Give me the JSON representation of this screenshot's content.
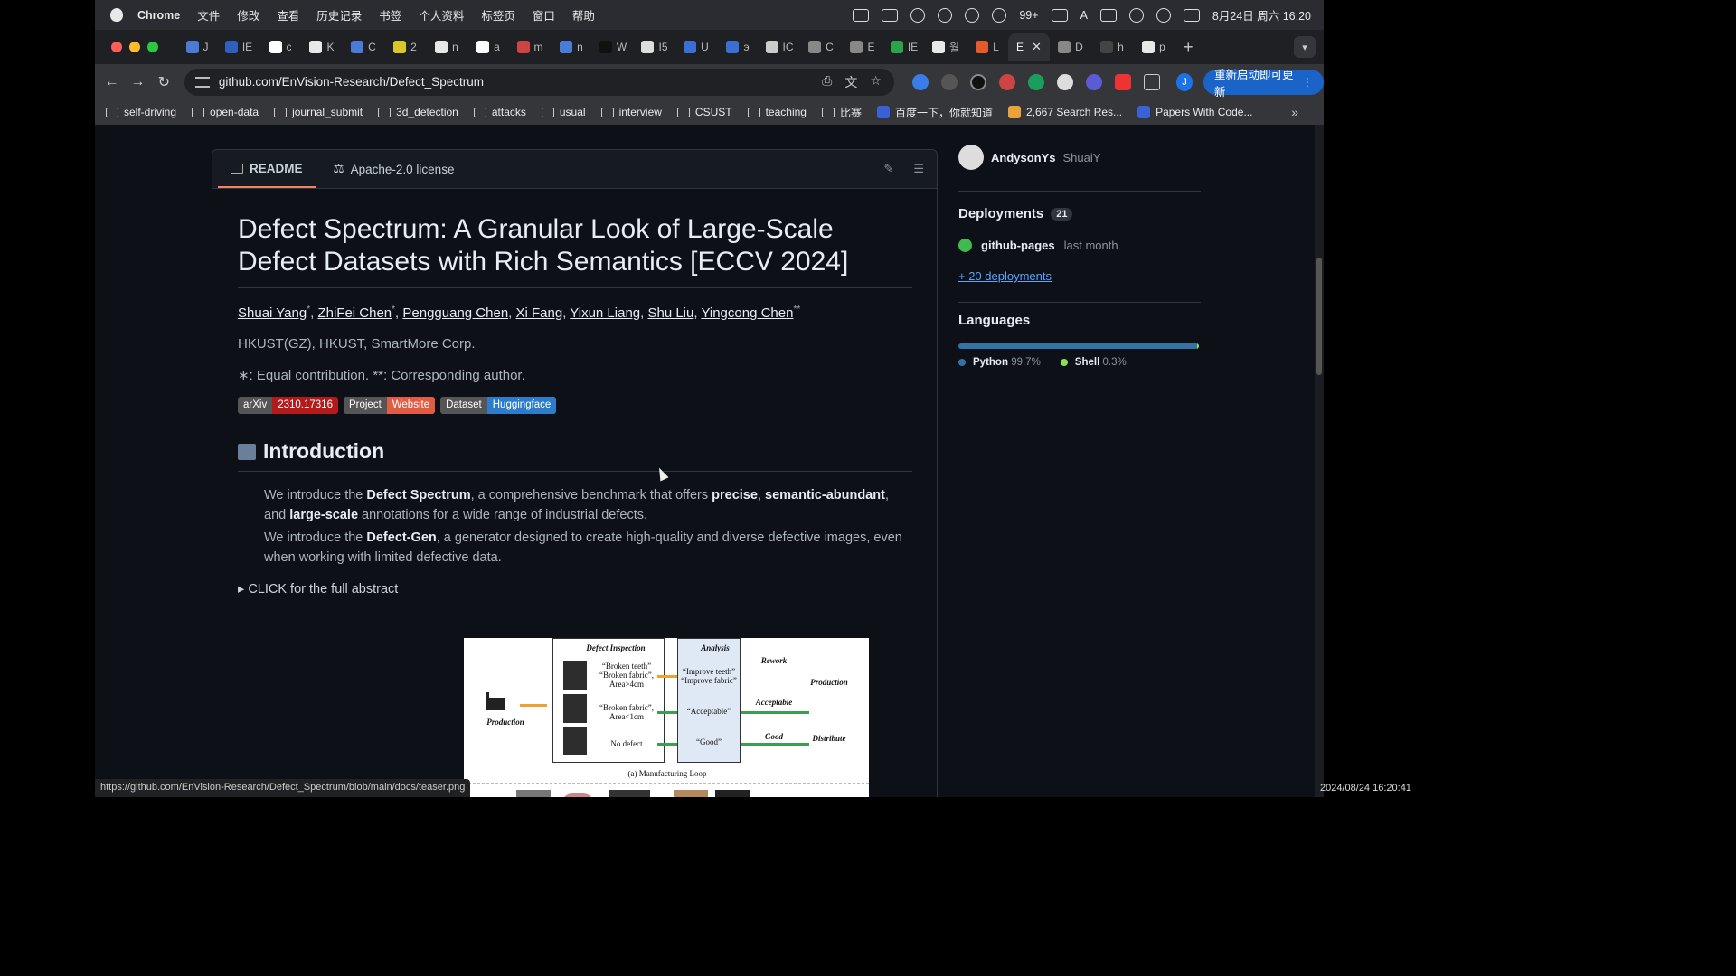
{
  "menubar": {
    "app": "Chrome",
    "items": [
      "文件",
      "修改",
      "查看",
      "历史记录",
      "书签",
      "个人资料",
      "标签页",
      "窗口",
      "帮助"
    ],
    "wechat_badge": "99+",
    "input_indicator": "A",
    "datetime": "8月24日 周六 16:20"
  },
  "tabs": [
    {
      "label": "J",
      "color": "#4a7bd6"
    },
    {
      "label": "IE",
      "color": "#2f5fbf"
    },
    {
      "label": "c",
      "color": "#ffffff"
    },
    {
      "label": "K",
      "color": "#e8e8e8"
    },
    {
      "label": "C",
      "color": "#4a7bd6"
    },
    {
      "label": "2",
      "color": "#d9c629"
    },
    {
      "label": "n",
      "color": "#e8e8e8"
    },
    {
      "label": "a",
      "color": "#ffffff"
    },
    {
      "label": "m",
      "color": "#c44"
    },
    {
      "label": "n",
      "color": "#4a7bd6"
    },
    {
      "label": "W",
      "color": "#111111"
    },
    {
      "label": "I5",
      "color": "#dddddd"
    },
    {
      "label": "U",
      "color": "#3b6fd6"
    },
    {
      "label": "э",
      "color": "#3b6fd6"
    },
    {
      "label": "IC",
      "color": "#cccccc"
    },
    {
      "label": "C",
      "color": "#888888"
    },
    {
      "label": "E",
      "color": "#888888"
    },
    {
      "label": "IE",
      "color": "#2aa34a"
    },
    {
      "label": "월",
      "color": "#e8e8e8"
    },
    {
      "label": "L",
      "color": "#e55a2b"
    },
    {
      "label": "E",
      "color": "#2f3035",
      "active": true
    },
    {
      "label": "D",
      "color": "#888888"
    },
    {
      "label": "h",
      "color": "#444444"
    },
    {
      "label": "p",
      "color": "#e8e8e8"
    }
  ],
  "toolbar": {
    "url": "github.com/EnVision-Research/Defect_Spectrum",
    "profile_initial": "J",
    "update_label": "重新启动即可更新"
  },
  "bookmarks": [
    {
      "label": "self-driving",
      "type": "folder"
    },
    {
      "label": "open-data",
      "type": "folder"
    },
    {
      "label": "journal_submit",
      "type": "folder"
    },
    {
      "label": "3d_detection",
      "type": "folder"
    },
    {
      "label": "attacks",
      "type": "folder"
    },
    {
      "label": "usual",
      "type": "folder"
    },
    {
      "label": "interview",
      "type": "folder"
    },
    {
      "label": "CSUST",
      "type": "folder"
    },
    {
      "label": "teaching",
      "type": "folder"
    },
    {
      "label": "比赛",
      "type": "folder"
    },
    {
      "label": "百度一下，你就知道",
      "type": "site",
      "color": "#3a62d6"
    },
    {
      "label": "2,667 Search Res...",
      "type": "site",
      "color": "#e8a33a"
    },
    {
      "label": "Papers With Code...",
      "type": "site",
      "color": "#3a62d6"
    }
  ],
  "readme": {
    "tab_readme": "README",
    "tab_license": "Apache-2.0 license",
    "title": "Defect Spectrum: A Granular Look of Large-Scale Defect Datasets with Rich Semantics [ECCV 2024]",
    "authors": [
      {
        "name": "Shuai Yang",
        "sup": "*"
      },
      {
        "name": "ZhiFei Chen",
        "sup": "*"
      },
      {
        "name": "Pengguang Chen",
        "sup": ""
      },
      {
        "name": "Xi Fang",
        "sup": ""
      },
      {
        "name": "Yixun Liang",
        "sup": ""
      },
      {
        "name": "Shu Liu",
        "sup": ""
      },
      {
        "name": "Yingcong Chen",
        "sup": "**"
      }
    ],
    "affiliations": "HKUST(GZ), HKUST, SmartMore Corp.",
    "contribution_note": "∗: Equal contribution. **: Corresponding author.",
    "badges": [
      {
        "left": "arXiv",
        "right": "2310.17316",
        "color": "#b31b1b"
      },
      {
        "left": "Project",
        "right": "Website",
        "color": "#e05d44"
      },
      {
        "left": "Dataset",
        "right": "Huggingface",
        "color": "#2d7cc9"
      }
    ],
    "intro_heading": "Introduction",
    "intro_p1": {
      "a": "We introduce the ",
      "b": "Defect Spectrum",
      "c": ", a comprehensive benchmark that offers ",
      "d": "precise",
      "e": ", ",
      "f": "semantic-abundant",
      "g": ", and ",
      "h": "large-scale",
      "i": " annotations for a wide range of industrial defects."
    },
    "intro_p2": {
      "a": "We introduce the ",
      "b": "Defect-Gen",
      "c": ", a generator designed to create high-quality and diverse defective images, even when working with limited defective data."
    },
    "abstract_toggle": "CLICK for the full abstract",
    "teaser": {
      "defect_inspection": "Defect Inspection",
      "analysis": "Analysis",
      "production": "Production",
      "q1": "“Broken teeth” “Broken fabric”, Area>4cm",
      "q2": "“Broken fabric”, Area<1cm",
      "q3": "No defect",
      "a1": "“Improve teeth” “Improve fabric”",
      "a2": "“Acceptable”",
      "a3": "“Good”",
      "rework": "Rework",
      "acceptable": "Acceptable",
      "good": "Good",
      "production_out": "Production",
      "distribute": "Distribute",
      "caption": "(a) Manufacturing Loop"
    }
  },
  "sidebar": {
    "contributor_name": "AndysonYs",
    "contributor_login": "ShuaiY",
    "deployments_title": "Deployments",
    "deployments_count": "21",
    "deployment_env": "github-pages",
    "deployment_time": "last month",
    "more_deployments": "+ 20 deployments",
    "languages_title": "Languages",
    "languages": [
      {
        "name": "Python",
        "percent": "99.7%",
        "color": "#3572A5",
        "share": 99.7
      },
      {
        "name": "Shell",
        "percent": "0.3%",
        "color": "#89e051",
        "share": 0.3
      }
    ]
  },
  "statusbar_url": "https://github.com/EnVision-Research/Defect_Spectrum/blob/main/docs/teaser.png",
  "timestamp": "2024/08/24 16:20:41"
}
